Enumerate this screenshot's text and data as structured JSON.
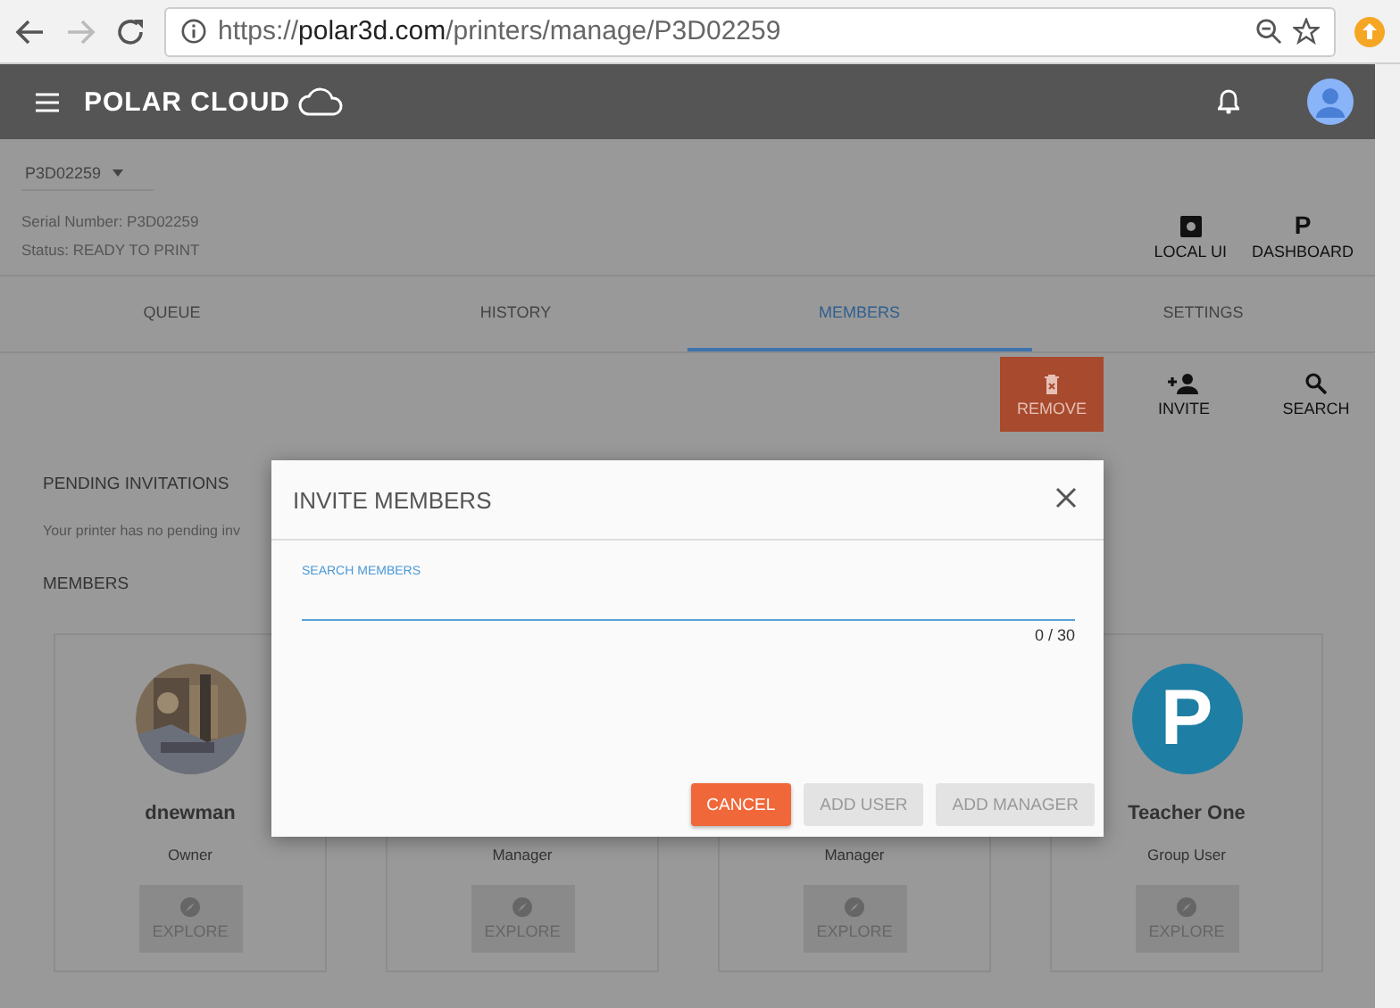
{
  "browser": {
    "url_scheme": "https://",
    "url_host": "polar3d.com",
    "url_path": "/printers/manage/P3D02259"
  },
  "header": {
    "brand": "POLAR CLOUD"
  },
  "printer_select": {
    "value": "P3D02259"
  },
  "serial": "Serial Number: P3D02259",
  "status": "Status: READY TO PRINT",
  "top_actions": [
    {
      "kind": "local",
      "label": "LOCAL UI"
    },
    {
      "kind": "dashboard",
      "label": "DASHBOARD",
      "icon_char": "P"
    }
  ],
  "tabs": [
    {
      "label": "QUEUE",
      "selected": false
    },
    {
      "label": "HISTORY",
      "selected": false
    },
    {
      "label": "MEMBERS",
      "selected": true
    },
    {
      "label": "SETTINGS",
      "selected": false
    }
  ],
  "member_actions": [
    {
      "kind": "remove",
      "label": "REMOVE"
    },
    {
      "kind": "invite",
      "label": "INVITE"
    },
    {
      "kind": "search",
      "label": "SEARCH"
    }
  ],
  "pending": {
    "heading": "PENDING INVITATIONS",
    "text": "Your printer has no pending inv"
  },
  "members_heading": "MEMBERS",
  "members": [
    {
      "name": "dnewman",
      "role": "Owner",
      "action": "EXPLORE"
    },
    {
      "role": "Manager",
      "action": "EXPLORE"
    },
    {
      "role": "Manager",
      "action": "EXPLORE"
    },
    {
      "name": "Teacher One",
      "role": "Group User",
      "avatar": {
        "kind": "letter",
        "char": "P"
      },
      "action": "EXPLORE"
    }
  ],
  "dialog": {
    "title": "INVITE MEMBERS",
    "field_label": "SEARCH MEMBERS",
    "counter": "0 / 30",
    "buttons": [
      {
        "label": "CANCEL",
        "kind": "primary",
        "disabled": false
      },
      {
        "label": "ADD USER",
        "kind": "flat",
        "disabled": true
      },
      {
        "label": "ADD MANAGER",
        "kind": "flat",
        "disabled": true
      }
    ]
  }
}
